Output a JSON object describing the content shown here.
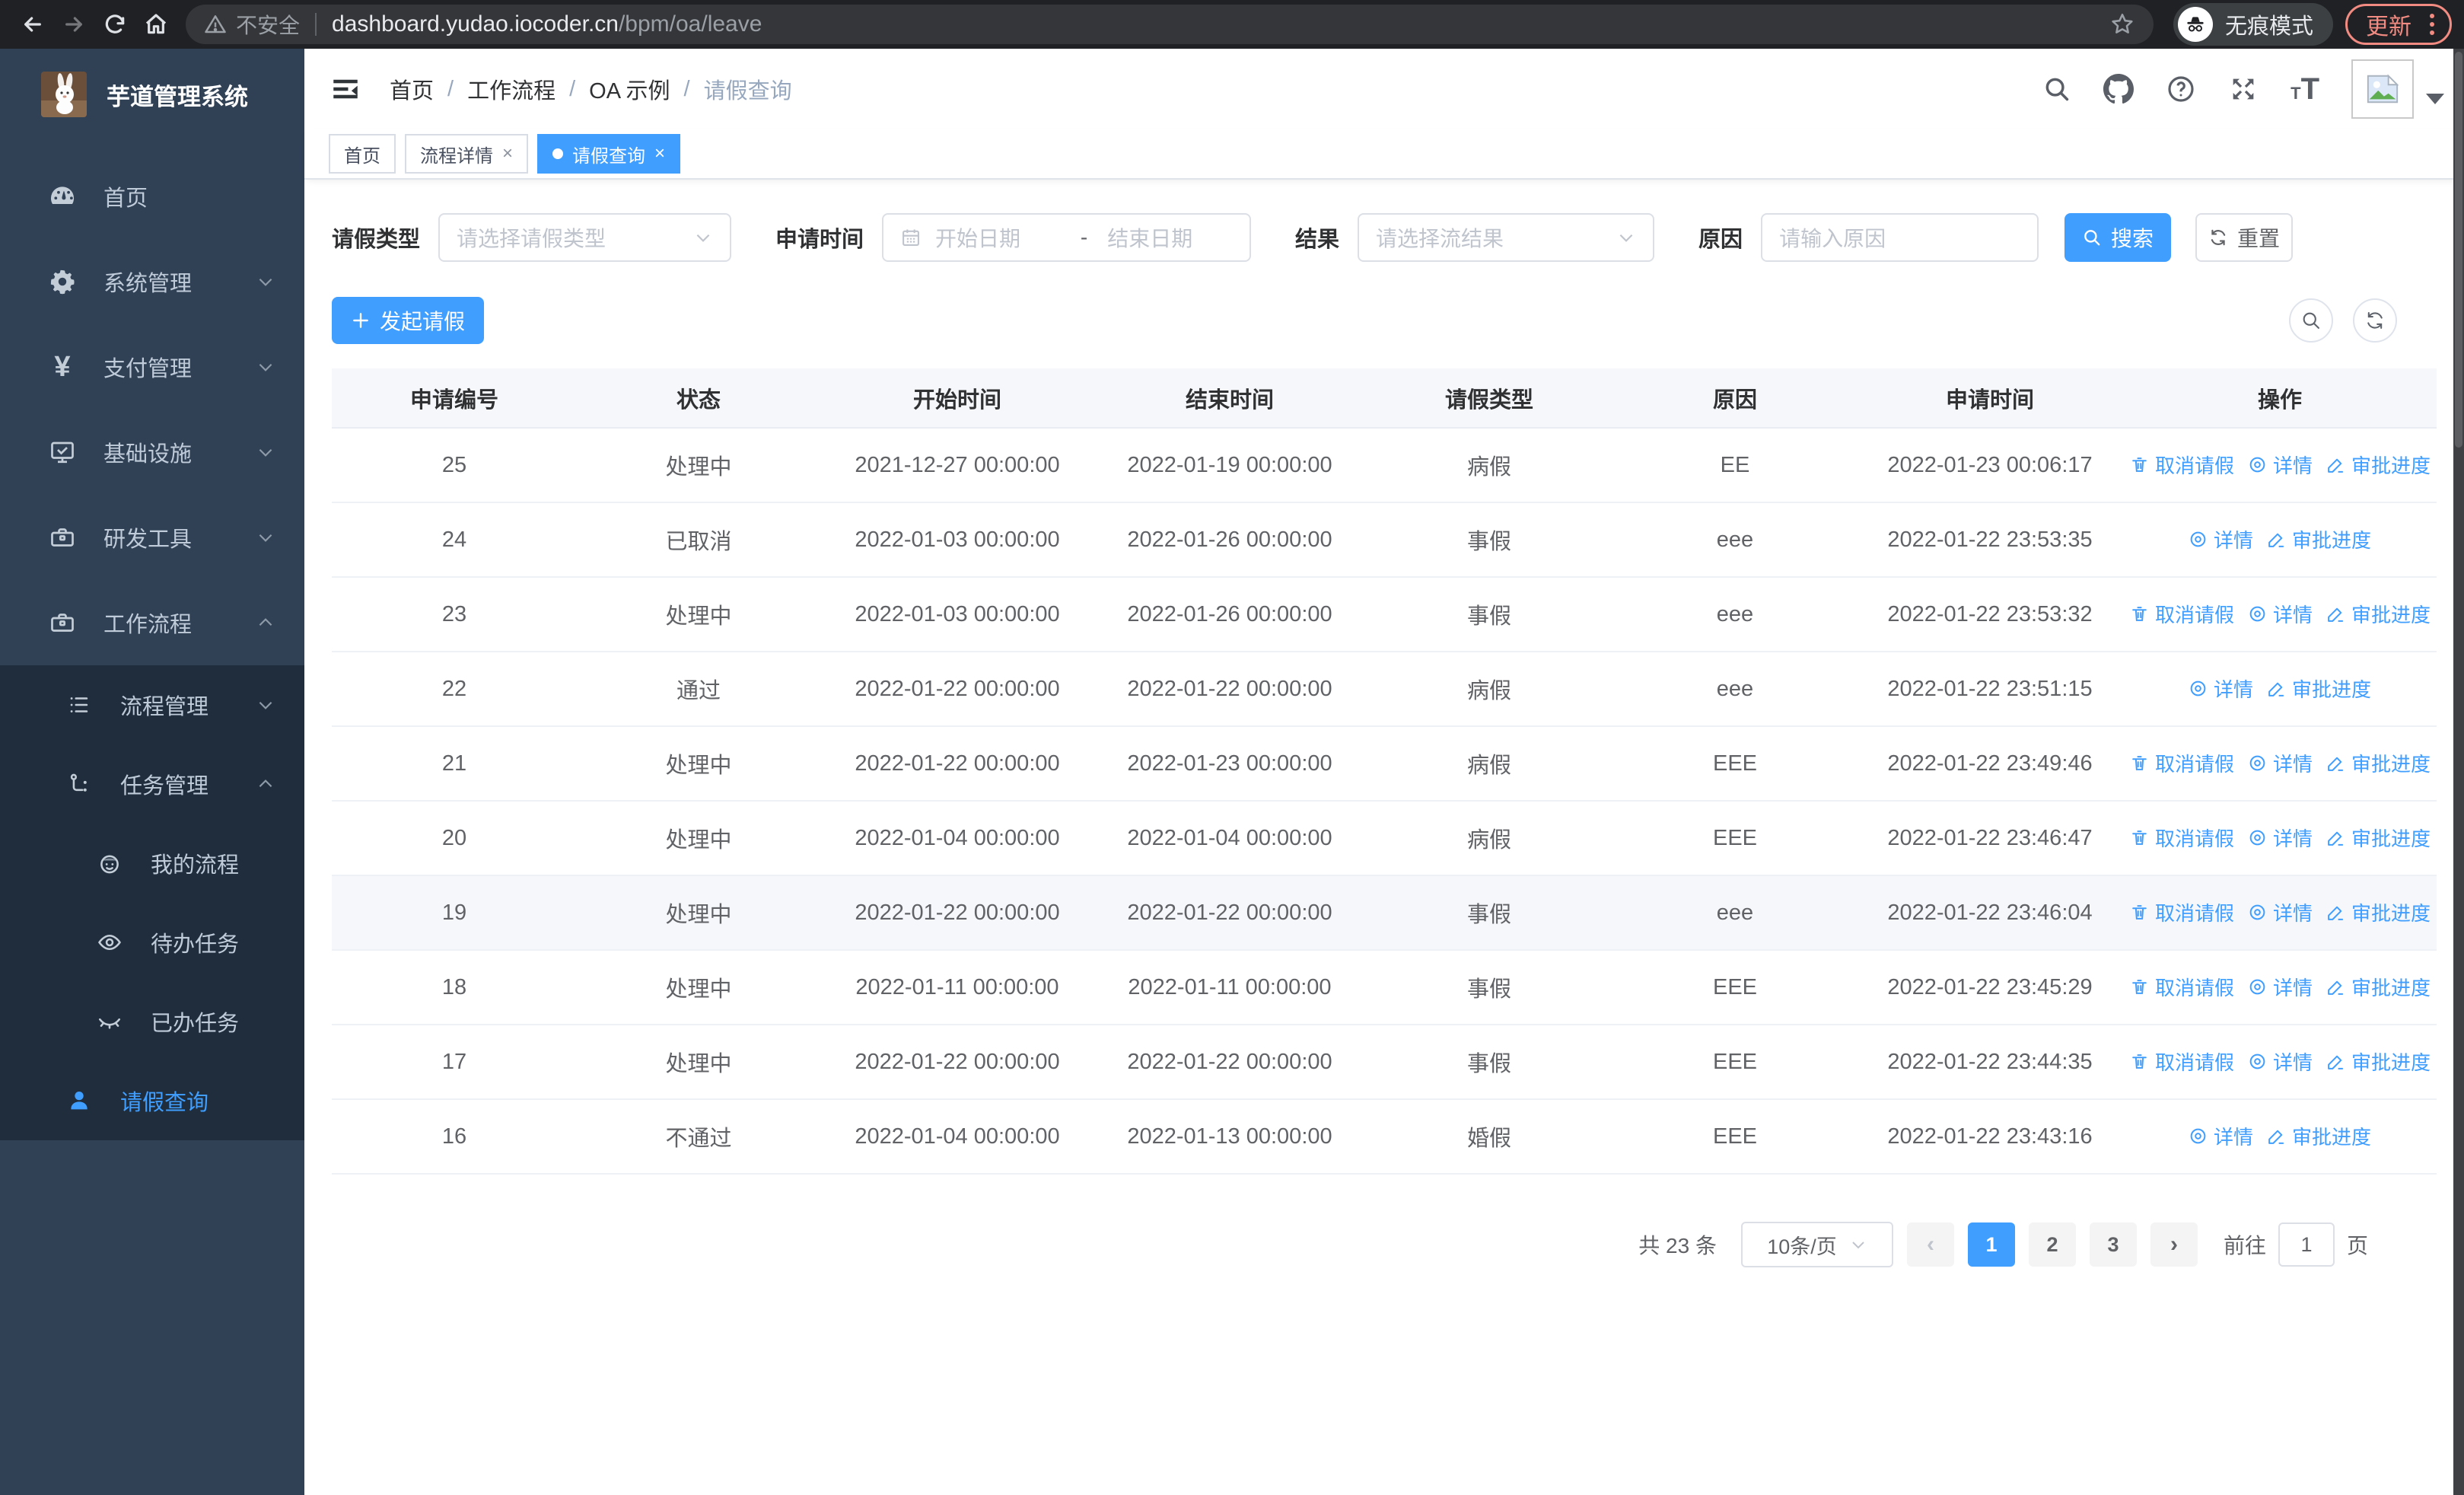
{
  "browser": {
    "security_label": "不安全",
    "url_host": "dashboard.yudao.iocoder.cn",
    "url_path": "/bpm/oa/leave",
    "incognito_label": "无痕模式",
    "update_label": "更新"
  },
  "sidebar": {
    "title": "芋道管理系统",
    "items": [
      {
        "label": "首页",
        "icon": "dashboard-icon"
      },
      {
        "label": "系统管理",
        "icon": "gear-icon"
      },
      {
        "label": "支付管理",
        "icon": "yen-icon"
      },
      {
        "label": "基础设施",
        "icon": "monitor-icon"
      },
      {
        "label": "研发工具",
        "icon": "toolbox-icon"
      },
      {
        "label": "工作流程",
        "icon": "briefcase-icon"
      }
    ],
    "workflow_children": [
      {
        "label": "流程管理",
        "icon": "list-icon"
      },
      {
        "label": "任务管理",
        "icon": "flow-icon"
      }
    ],
    "task_children": [
      {
        "label": "我的流程",
        "icon": "robot-icon"
      },
      {
        "label": "待办任务",
        "icon": "eye-open-icon"
      },
      {
        "label": "已办任务",
        "icon": "eye-closed-icon"
      }
    ],
    "leave_item": {
      "label": "请假查询",
      "icon": "user-icon"
    }
  },
  "header": {
    "breadcrumb": [
      "首页",
      "工作流程",
      "OA 示例",
      "请假查询"
    ],
    "breadcrumb_separator": "/",
    "tabs": [
      {
        "label": "首页"
      },
      {
        "label": "流程详情"
      },
      {
        "label": "请假查询"
      }
    ],
    "tab_close": "×"
  },
  "filters": {
    "type_label": "请假类型",
    "type_placeholder": "请选择请假类型",
    "time_label": "申请时间",
    "time_start_placeholder": "开始日期",
    "time_separator": "-",
    "time_end_placeholder": "结束日期",
    "result_label": "结果",
    "result_placeholder": "请选择流结果",
    "reason_label": "原因",
    "reason_placeholder": "请输入原因",
    "search_label": "搜索",
    "reset_label": "重置"
  },
  "toolbar": {
    "create_label": "发起请假"
  },
  "table": {
    "columns": [
      "申请编号",
      "状态",
      "开始时间",
      "结束时间",
      "请假类型",
      "原因",
      "申请时间",
      "操作"
    ],
    "action_labels": {
      "cancel": "取消请假",
      "detail": "详情",
      "progress": "审批进度"
    },
    "rows": [
      {
        "id": "25",
        "status": "处理中",
        "start": "2021-12-27 00:00:00",
        "end": "2022-01-19 00:00:00",
        "type": "病假",
        "reason": "EE",
        "apply_time": "2022-01-23 00:06:17",
        "actions": [
          "cancel",
          "detail",
          "progress"
        ],
        "highlighted": false
      },
      {
        "id": "24",
        "status": "已取消",
        "start": "2022-01-03 00:00:00",
        "end": "2022-01-26 00:00:00",
        "type": "事假",
        "reason": "eee",
        "apply_time": "2022-01-22 23:53:35",
        "actions": [
          "detail",
          "progress"
        ],
        "highlighted": false
      },
      {
        "id": "23",
        "status": "处理中",
        "start": "2022-01-03 00:00:00",
        "end": "2022-01-26 00:00:00",
        "type": "事假",
        "reason": "eee",
        "apply_time": "2022-01-22 23:53:32",
        "actions": [
          "cancel",
          "detail",
          "progress"
        ],
        "highlighted": false
      },
      {
        "id": "22",
        "status": "通过",
        "start": "2022-01-22 00:00:00",
        "end": "2022-01-22 00:00:00",
        "type": "病假",
        "reason": "eee",
        "apply_time": "2022-01-22 23:51:15",
        "actions": [
          "detail",
          "progress"
        ],
        "highlighted": false
      },
      {
        "id": "21",
        "status": "处理中",
        "start": "2022-01-22 00:00:00",
        "end": "2022-01-23 00:00:00",
        "type": "病假",
        "reason": "EEE",
        "apply_time": "2022-01-22 23:49:46",
        "actions": [
          "cancel",
          "detail",
          "progress"
        ],
        "highlighted": false
      },
      {
        "id": "20",
        "status": "处理中",
        "start": "2022-01-04 00:00:00",
        "end": "2022-01-04 00:00:00",
        "type": "病假",
        "reason": "EEE",
        "apply_time": "2022-01-22 23:46:47",
        "actions": [
          "cancel",
          "detail",
          "progress"
        ],
        "highlighted": false
      },
      {
        "id": "19",
        "status": "处理中",
        "start": "2022-01-22 00:00:00",
        "end": "2022-01-22 00:00:00",
        "type": "事假",
        "reason": "eee",
        "apply_time": "2022-01-22 23:46:04",
        "actions": [
          "cancel",
          "detail",
          "progress"
        ],
        "highlighted": true
      },
      {
        "id": "18",
        "status": "处理中",
        "start": "2022-01-11 00:00:00",
        "end": "2022-01-11 00:00:00",
        "type": "事假",
        "reason": "EEE",
        "apply_time": "2022-01-22 23:45:29",
        "actions": [
          "cancel",
          "detail",
          "progress"
        ],
        "highlighted": false
      },
      {
        "id": "17",
        "status": "处理中",
        "start": "2022-01-22 00:00:00",
        "end": "2022-01-22 00:00:00",
        "type": "事假",
        "reason": "EEE",
        "apply_time": "2022-01-22 23:44:35",
        "actions": [
          "cancel",
          "detail",
          "progress"
        ],
        "highlighted": false
      },
      {
        "id": "16",
        "status": "不通过",
        "start": "2022-01-04 00:00:00",
        "end": "2022-01-13 00:00:00",
        "type": "婚假",
        "reason": "EEE",
        "apply_time": "2022-01-22 23:43:16",
        "actions": [
          "detail",
          "progress"
        ],
        "highlighted": false
      }
    ]
  },
  "pagination": {
    "total_label": "共 23 条",
    "page_size_label": "10条/页",
    "pages": [
      "1",
      "2",
      "3"
    ],
    "active_page": "1",
    "prev_symbol": "‹",
    "next_symbol": "›",
    "jump_prefix": "前往",
    "jump_value": "1",
    "jump_suffix": "页"
  }
}
